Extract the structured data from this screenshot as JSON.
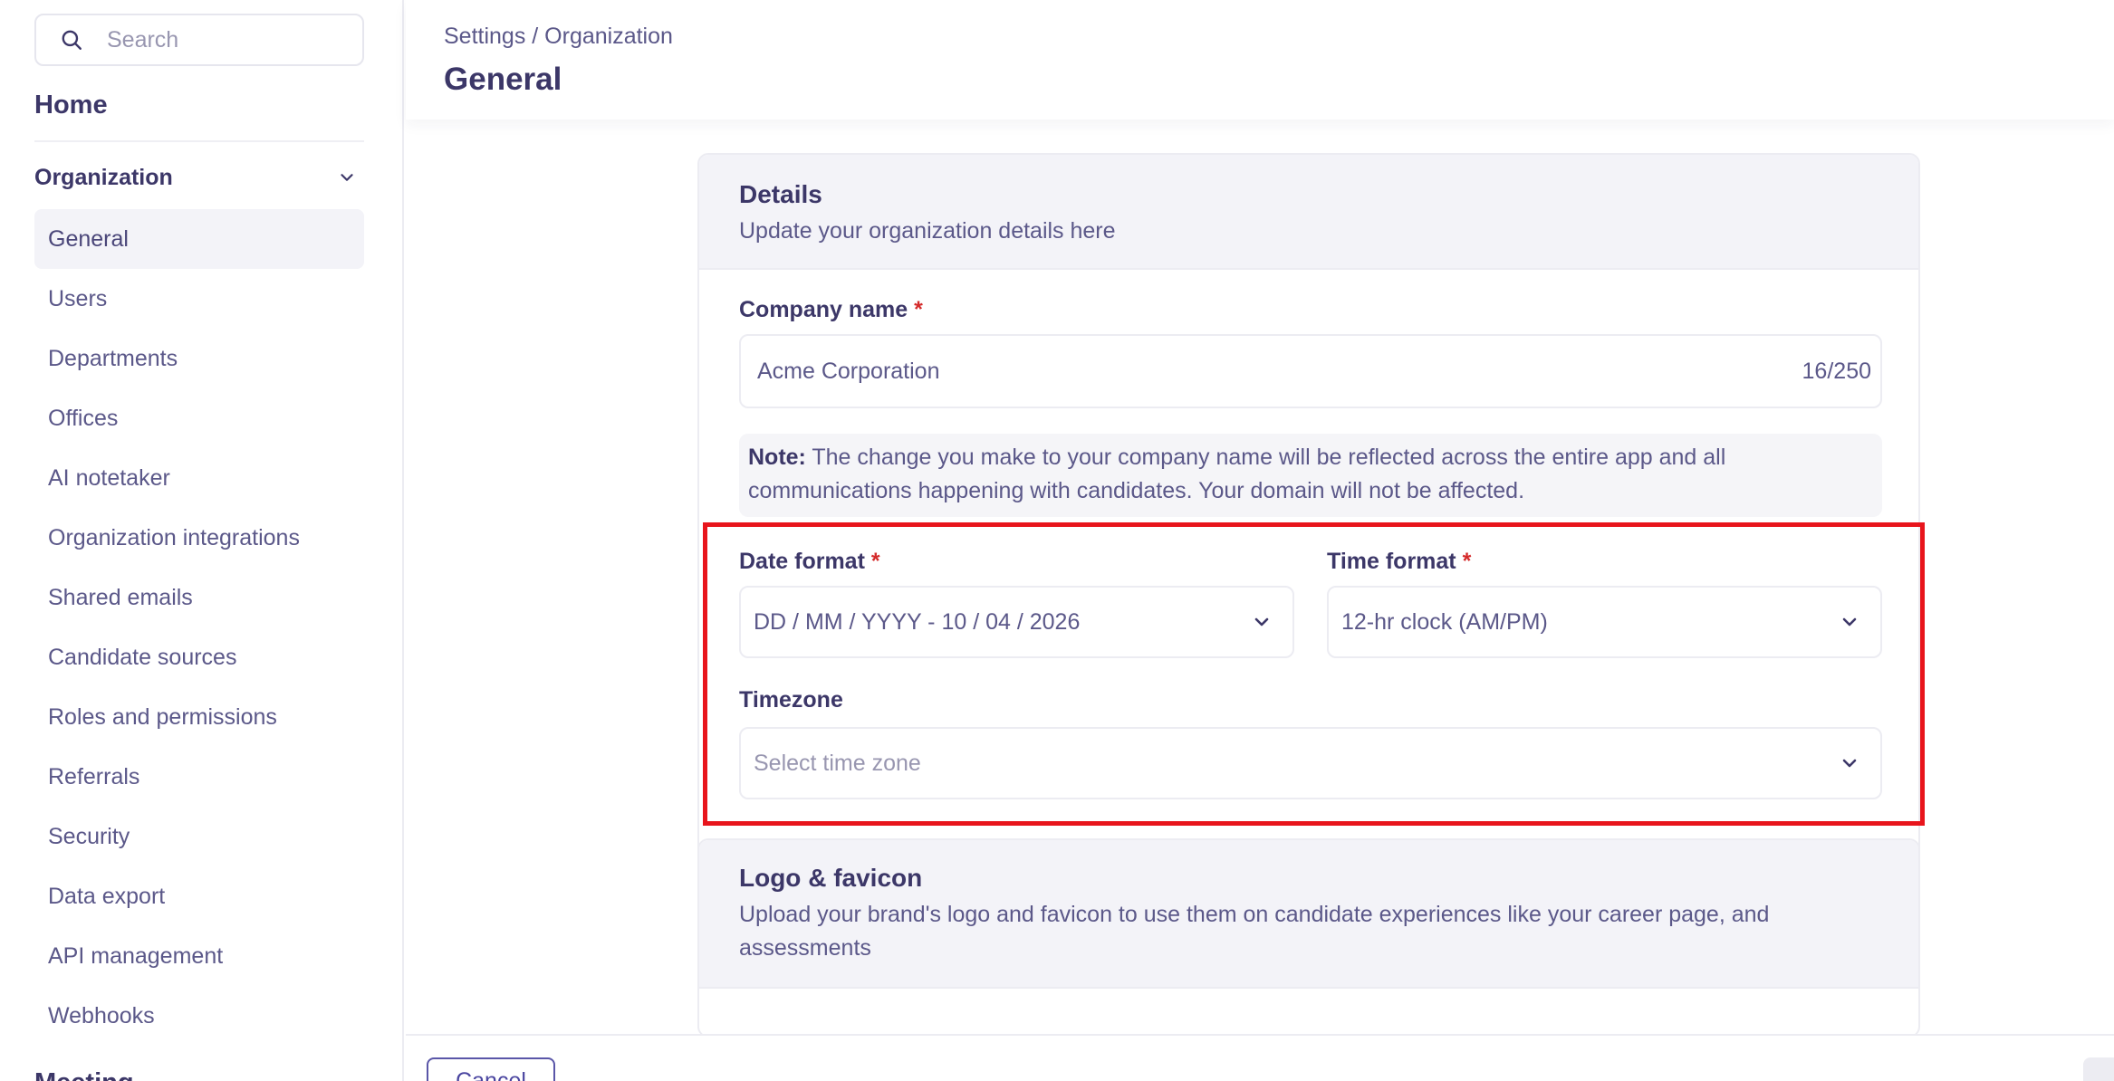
{
  "sidebar": {
    "search_placeholder": "Search",
    "home_label": "Home",
    "section_label": "Organization",
    "items": [
      {
        "label": "General"
      },
      {
        "label": "Users"
      },
      {
        "label": "Departments"
      },
      {
        "label": "Offices"
      },
      {
        "label": "AI notetaker"
      },
      {
        "label": "Organization integrations"
      },
      {
        "label": "Shared emails"
      },
      {
        "label": "Candidate sources"
      },
      {
        "label": "Roles and permissions"
      },
      {
        "label": "Referrals"
      },
      {
        "label": "Security"
      },
      {
        "label": "Data export"
      },
      {
        "label": "API management"
      },
      {
        "label": "Webhooks"
      }
    ],
    "next_section_label": "Meeting"
  },
  "header": {
    "breadcrumb": "Settings / Organization",
    "title": "General"
  },
  "details": {
    "title": "Details",
    "subtitle": "Update your organization details here",
    "company_name_label": "Company name",
    "required_mark": "*",
    "company_name_value": "Acme Corporation",
    "company_name_counter": "16/250",
    "note_bold": "Note:",
    "note_text": " The change you make to your company name will be reflected across the entire app and all communications happening with candidates. Your domain will not be affected.",
    "date_format_label": "Date format",
    "date_format_value": "DD / MM / YYYY - 10 / 04 / 2026",
    "time_format_label": "Time format",
    "time_format_value": "12-hr clock (AM/PM)",
    "timezone_label": "Timezone",
    "timezone_placeholder": "Select time zone"
  },
  "logo": {
    "title": "Logo & favicon",
    "subtitle": "Upload your brand's logo and favicon to use them on candidate experiences like your career page, and assessments"
  },
  "footer": {
    "cancel_label": "Cancel"
  },
  "colors": {
    "text_primary": "#3c3768",
    "required": "#d42a2a",
    "highlight": "#e8151c"
  }
}
